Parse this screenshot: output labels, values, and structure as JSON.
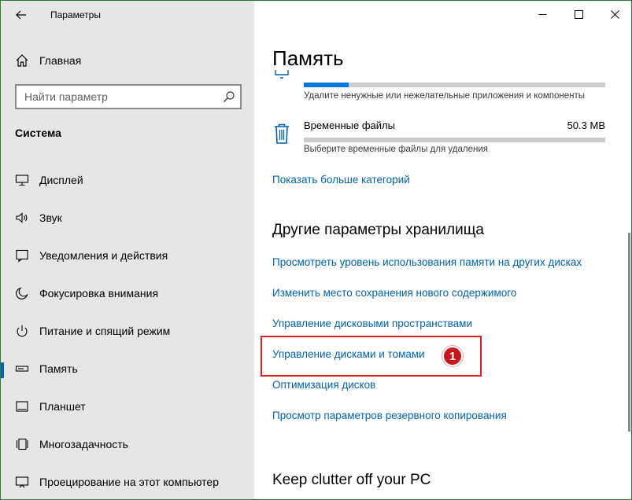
{
  "window": {
    "title": "Параметры"
  },
  "sidebar": {
    "home_label": "Главная",
    "search_placeholder": "Найти параметр",
    "section_title": "Система",
    "items": [
      {
        "label": "Дисплей",
        "icon": "monitor-icon"
      },
      {
        "label": "Звук",
        "icon": "speaker-icon"
      },
      {
        "label": "Уведомления и действия",
        "icon": "notification-icon"
      },
      {
        "label": "Фокусировка внимания",
        "icon": "moon-icon"
      },
      {
        "label": "Питание и спящий режим",
        "icon": "power-icon"
      },
      {
        "label": "Память",
        "icon": "storage-icon",
        "active": true
      },
      {
        "label": "Планшет",
        "icon": "tablet-icon"
      },
      {
        "label": "Многозадачность",
        "icon": "multitasking-icon"
      },
      {
        "label": "Проецирование на этот компьютер",
        "icon": "projection-icon"
      }
    ]
  },
  "main": {
    "page_title": "Память",
    "apps_category": {
      "description": "Удалите ненужные или нежелательные приложения и компоненты",
      "usage_fraction": 0.15
    },
    "temp_category": {
      "name": "Временные файлы",
      "size": "50.3 MB",
      "description": "Выберите временные файлы для удаления",
      "usage_fraction": 0.0
    },
    "show_more_link": "Показать больше категорий",
    "other_settings_title": "Другие параметры хранилища",
    "other_links": [
      "Просмотреть уровень использования памяти на других дисках",
      "Изменить место сохранения нового содержимого",
      "Управление дисковыми пространствами",
      "Управление дисками и томами",
      "Оптимизация дисков",
      "Просмотр параметров резервного копирования"
    ],
    "highlight_badge": "1",
    "clutter_title": "Keep clutter off your PC"
  },
  "colors": {
    "accent": "#0078d7",
    "link": "#0063b1",
    "highlight": "#e02020",
    "sidebar_bg": "#e6e6e6"
  }
}
